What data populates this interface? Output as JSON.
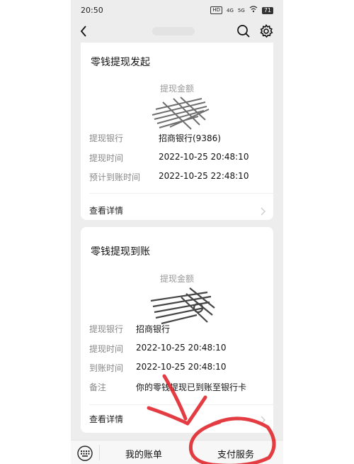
{
  "status_bar": {
    "time": "20:50",
    "hd_badge": "HD",
    "net_4g": "4G",
    "net_5g": "5G",
    "battery": "71"
  },
  "navbar": {
    "back_icon": "back-arrow-icon",
    "search_icon": "search-icon",
    "settings_icon": "gear-icon"
  },
  "card1": {
    "title": "零钱提现发起",
    "amount_label": "提现金额",
    "rows": [
      {
        "label": "提现银行",
        "value": "招商银行(9386)"
      },
      {
        "label": "提现时间",
        "value": "2022-10-25 20:48:10"
      },
      {
        "label": "预计到账时间",
        "value": "2022-10-25 22:48:10"
      }
    ],
    "detail_label": "查看详情"
  },
  "card2": {
    "title": "零钱提现到账",
    "amount_label": "提现金额",
    "rows": [
      {
        "label": "提现银行",
        "value": "招商银行"
      },
      {
        "label": "提现时间",
        "value": "2022-10-25 20:48:10"
      },
      {
        "label": "到账时间",
        "value": "2022-10-25 20:48:10"
      },
      {
        "label": "备注",
        "value": "你的零钱提现已到账至银行卡"
      }
    ],
    "detail_label": "查看详情"
  },
  "tabbar": {
    "keyboard_icon": "keyboard-icon",
    "tab_bills": "我的账单",
    "tab_services": "支付服务"
  },
  "colors": {
    "background": "#ededed",
    "card": "#ffffff",
    "label_gray": "#888888",
    "annotation_red": "#e0282e"
  }
}
